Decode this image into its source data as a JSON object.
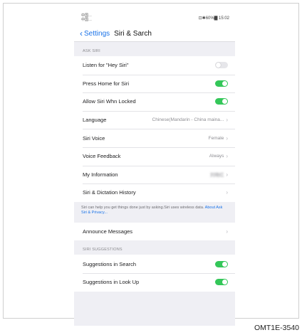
{
  "status_bar": {
    "carrier_line1": "中国…",
    "carrier_line2": "中国…",
    "right": "⊡✱60%▇ 15:02"
  },
  "nav": {
    "back_label": "Settings",
    "title": "Siri & Sarch"
  },
  "ask_siri": {
    "header": "ASK SIRI",
    "rows": [
      {
        "label": "Listen for \"Hey Siri\"",
        "toggle": "off"
      },
      {
        "label": "Press Home for Siri",
        "toggle": "on"
      },
      {
        "label": "Allow Siri Whn Locked",
        "toggle": "on"
      },
      {
        "label": "Language",
        "value": "Chinese(Mandarin - China maina..."
      },
      {
        "label": "Siri Voice",
        "value": "Female"
      },
      {
        "label": "Voice Feedback",
        "value": "Always"
      },
      {
        "label": "My Information",
        "value": "刘晓红"
      },
      {
        "label": "Siri & Dictation History"
      }
    ],
    "footnote": "Siri can help you get things done just by asking.Siri uses wireless data. ",
    "footnote_link": "About Ask Siri & Privacy..."
  },
  "announce": {
    "label": "Announce Messages"
  },
  "suggestions": {
    "header": "SIRI SUGGESTIONS",
    "rows": [
      {
        "label": "Suggestions in Search",
        "toggle": "on"
      },
      {
        "label": "Suggestions in Look Up",
        "toggle": "on"
      }
    ]
  },
  "caption": "OMT1E-3540",
  "colors": {
    "accent": "#1a73e8",
    "toggle_on": "#34c759",
    "background": "#efeff4"
  },
  "icons": [
    "chevron-left-icon",
    "chevron-right-icon"
  ]
}
